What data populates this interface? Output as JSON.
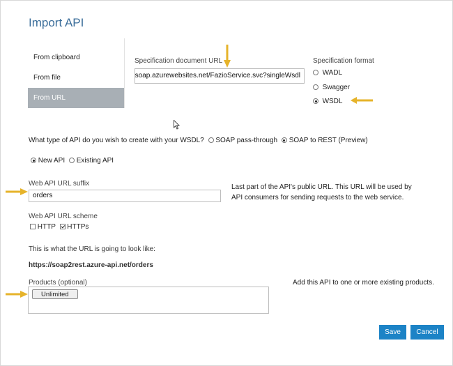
{
  "dialog": {
    "title": "Import API"
  },
  "tabs": [
    {
      "label": "From clipboard"
    },
    {
      "label": "From file"
    },
    {
      "label": "From URL"
    }
  ],
  "spec_url": {
    "label": "Specification document URL",
    "value": "apisoap.azurewebsites.net/FazioService.svc?singleWsdl"
  },
  "spec_format": {
    "label": "Specification format",
    "options": [
      "WADL",
      "Swagger",
      "WSDL"
    ],
    "selected": "WSDL"
  },
  "api_type": {
    "question": "What type of API do you wish to create with your WSDL?",
    "options": [
      "SOAP pass-through",
      "SOAP to REST (Preview)"
    ],
    "selected": "SOAP to REST (Preview)"
  },
  "api_mode": {
    "options": [
      "New API",
      "Existing API"
    ],
    "selected": "New API"
  },
  "url_suffix": {
    "label": "Web API URL suffix",
    "value": "orders",
    "help_line1": "Last part of the API's public URL. This URL will be used by",
    "help_line2": "API consumers for sending requests to the web service."
  },
  "url_scheme": {
    "label": "Web API URL scheme",
    "options": [
      "HTTP",
      "HTTPs"
    ],
    "checked": [
      "HTTPs"
    ]
  },
  "preview": {
    "label": "This is what the URL is going to look like:",
    "url": "https://soap2rest.azure-api.net/orders"
  },
  "products": {
    "label": "Products (optional)",
    "tags": [
      "Unlimited"
    ],
    "help": "Add this API to one or more existing products."
  },
  "actions": {
    "save": "Save",
    "cancel": "Cancel"
  },
  "colors": {
    "accent": "#1c83c6",
    "title": "#3a6d9a",
    "arrow": "#e6b32a",
    "tab_active": "#a8afb5"
  }
}
